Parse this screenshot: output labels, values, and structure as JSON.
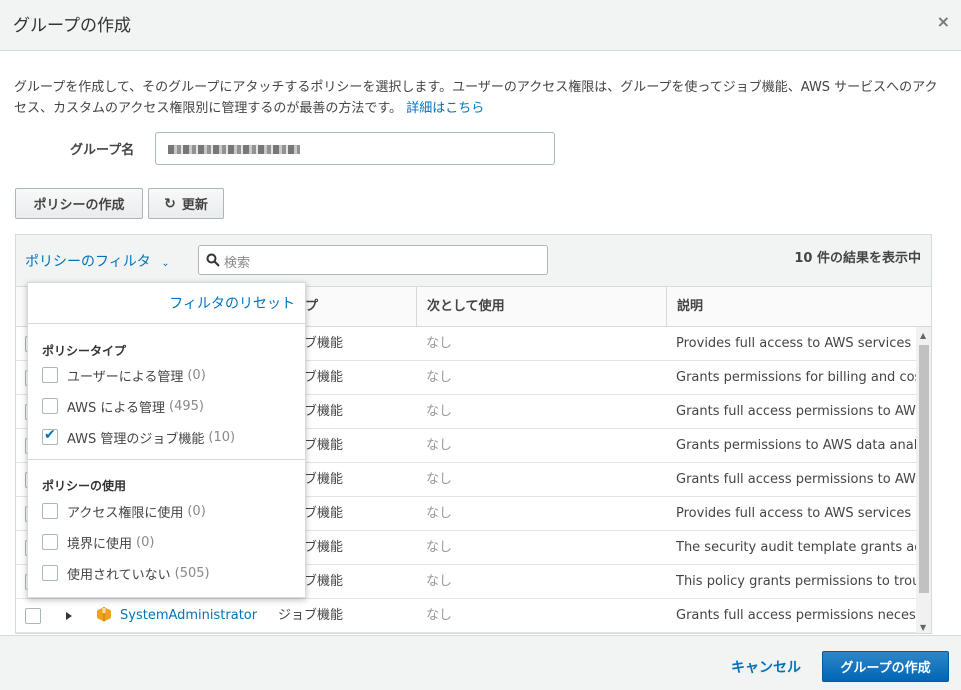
{
  "dialog": {
    "title": "グループの作成",
    "close_icon": "×",
    "description": "グループを作成して、そのグループにアタッチするポリシーを選択します。ユーザーのアクセス権限は、グループを使ってジョブ機能、AWS サービスへのアクセス、カスタムのアクセス権限別に管理するのが最善の方法です。",
    "description_link": "詳細はこちら"
  },
  "group_name": {
    "label": "グループ名",
    "value": ""
  },
  "buttons": {
    "create_policy": "ポリシーの作成",
    "refresh": "更新"
  },
  "table": {
    "filter_label": "ポリシーのフィルタ",
    "search_placeholder": "検索",
    "result_count": "10 件の結果を表示中",
    "headers": {
      "type": "タイプ",
      "usage": "次として使用",
      "description": "説明"
    },
    "rows": [
      {
        "name": "",
        "type": "ジョブ機能",
        "usage": "なし",
        "description": "Provides full access to AWS services a"
      },
      {
        "name": "",
        "type": "ジョブ機能",
        "usage": "なし",
        "description": "Grants permissions for billing and cost."
      },
      {
        "name": "",
        "type": "ジョブ機能",
        "usage": "なし",
        "description": "Grants full access permissions to AWS"
      },
      {
        "name": "",
        "type": "ジョブ機能",
        "usage": "なし",
        "description": "Grants permissions to AWS data analy"
      },
      {
        "name": "",
        "type": "ジョブ機能",
        "usage": "なし",
        "description": "Grants full access permissions to AWS"
      },
      {
        "name": "",
        "type": "ジョブ機能",
        "usage": "なし",
        "description": "Provides full access to AWS services a"
      },
      {
        "name": "",
        "type": "ジョブ機能",
        "usage": "なし",
        "description": "The security audit template grants acc."
      },
      {
        "name": "",
        "type": "ジョブ機能",
        "usage": "なし",
        "description": "This policy grants permissions to troub"
      },
      {
        "name": "SystemAdministrator",
        "type": "ジョブ機能",
        "usage": "なし",
        "description": "Grants full access permissions necess"
      }
    ]
  },
  "filter_menu": {
    "reset": "フィルタのリセット",
    "group1_title": "ポリシータイプ",
    "group1": [
      {
        "label": "ユーザーによる管理",
        "count": "(0)",
        "checked": false
      },
      {
        "label": "AWS による管理",
        "count": "(495)",
        "checked": false
      },
      {
        "label": "AWS 管理のジョブ機能",
        "count": "(10)",
        "checked": true
      }
    ],
    "group2_title": "ポリシーの使用",
    "group2": [
      {
        "label": "アクセス権限に使用",
        "count": "(0)",
        "checked": false
      },
      {
        "label": "境界に使用",
        "count": "(0)",
        "checked": false
      },
      {
        "label": "使用されていない",
        "count": "(505)",
        "checked": false
      }
    ]
  },
  "footer": {
    "cancel": "キャンセル",
    "create_group": "グループの作成"
  },
  "colors": {
    "link": "#0073bb",
    "primary": "#0066b5",
    "header_bg": "#f2f3f3"
  },
  "icons": {
    "close": "close-icon",
    "refresh": "refresh-icon",
    "search": "search-icon",
    "chevron": "chevron-down-icon",
    "package": "package-icon"
  }
}
